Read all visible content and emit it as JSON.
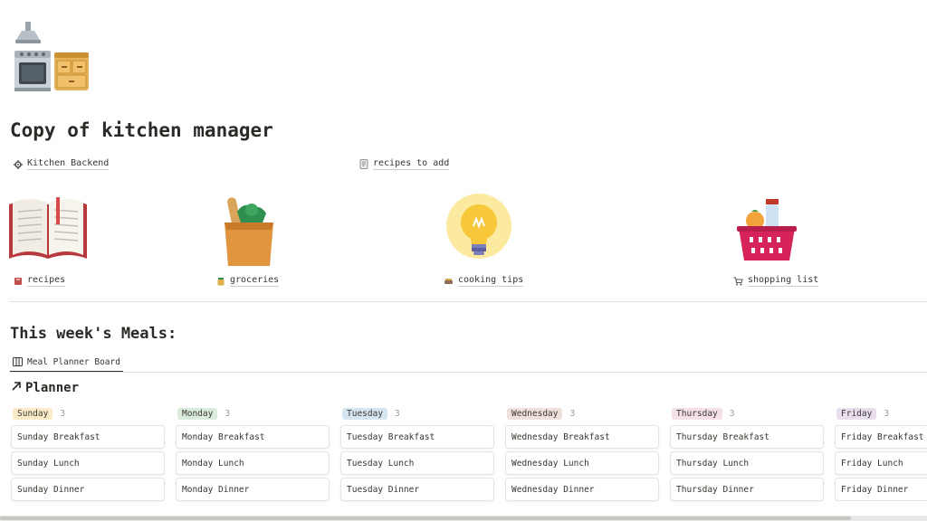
{
  "page": {
    "title": "Copy of kitchen manager",
    "icon": "kitchen-stove-icon"
  },
  "links": [
    {
      "label": "Kitchen Backend",
      "icon": "gear-icon"
    },
    {
      "label": "recipes to add",
      "icon": "document-icon"
    }
  ],
  "gallery": [
    {
      "label": "recipes",
      "icon": "open-book-icon",
      "mini_icon": "book-icon"
    },
    {
      "label": "groceries",
      "icon": "grocery-bag-icon",
      "mini_icon": "jar-icon"
    },
    {
      "label": "cooking tips",
      "icon": "light-bulb-icon",
      "mini_icon": "dish-icon"
    },
    {
      "label": "shopping list",
      "icon": "shopping-basket-icon",
      "mini_icon": "cart-icon"
    }
  ],
  "section": {
    "title": "This week's Meals:",
    "view_tab": "Meal Planner Board",
    "planner_title": "Planner"
  },
  "board": {
    "columns": [
      {
        "day": "Sunday",
        "count": "3",
        "color": "#fbecc7",
        "cards": [
          "Sunday Breakfast",
          "Sunday Lunch",
          "Sunday Dinner"
        ]
      },
      {
        "day": "Monday",
        "count": "3",
        "color": "#dcecdc",
        "cards": [
          "Monday Breakfast",
          "Monday Lunch",
          "Monday Dinner"
        ]
      },
      {
        "day": "Tuesday",
        "count": "3",
        "color": "#d6e6f0",
        "cards": [
          "Tuesday Breakfast",
          "Tuesday Lunch",
          "Tuesday Dinner"
        ]
      },
      {
        "day": "Wednesday",
        "count": "3",
        "color": "#eee0da",
        "cards": [
          "Wednesday Breakfast",
          "Wednesday Lunch",
          "Wednesday Dinner"
        ]
      },
      {
        "day": "Thursday",
        "count": "3",
        "color": "#f5dfe8",
        "cards": [
          "Thursday Breakfast",
          "Thursday Lunch",
          "Thursday Dinner"
        ]
      },
      {
        "day": "Friday",
        "count": "3",
        "color": "#e8deee",
        "cards": [
          "Friday Breakfast",
          "Friday Lunch",
          "Friday Dinner"
        ]
      }
    ]
  }
}
